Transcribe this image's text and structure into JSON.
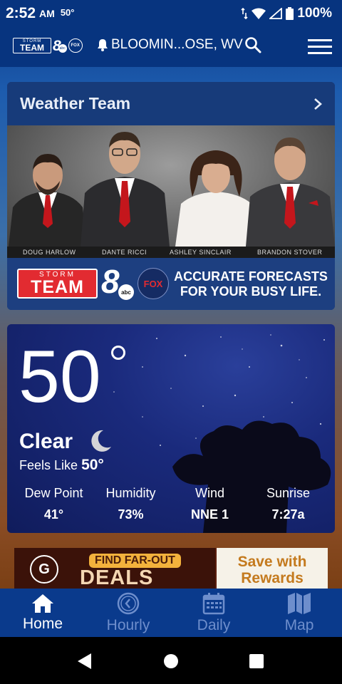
{
  "status_bar": {
    "time": "2:52",
    "ampm": "AM",
    "temperature": "50°",
    "battery": "100%"
  },
  "app_bar": {
    "logo_text_top": "STORM",
    "logo_text_bottom": "TEAM",
    "logo_channel": "8",
    "logo_abc": "abc",
    "logo_fox": "FOX",
    "location": "BLOOMIN...OSE, WV"
  },
  "weather_team": {
    "title": "Weather Team",
    "members": [
      "DOUG HARLOW",
      "DANTE RICCI",
      "ASHLEY SINCLAIR",
      "BRANDON STOVER"
    ],
    "promo": {
      "logo_top": "STORM",
      "logo_bottom": "TEAM",
      "channel": "8",
      "abc": "abc",
      "fox": "FOX",
      "tagline_1": "ACCURATE FORECASTS",
      "tagline_2": "FOR YOUR BUSY LIFE."
    }
  },
  "current": {
    "temperature": "50",
    "condition": "Clear",
    "feels_like_label": "Feels Like",
    "feels_like_value": "50°",
    "stats": [
      {
        "label": "Dew Point",
        "value": "41°"
      },
      {
        "label": "Humidity",
        "value": "73%"
      },
      {
        "label": "Wind",
        "value": "NNE 1"
      },
      {
        "label": "Sunrise",
        "value": "7:27a"
      }
    ]
  },
  "ad": {
    "logo": "G",
    "find_text": "FIND FAR-OUT",
    "deals_text": "DEALS",
    "right_text_1": "Save with",
    "right_text_2": "Rewards"
  },
  "bottom_nav": [
    {
      "label": "Home",
      "icon": "home-icon",
      "active": true
    },
    {
      "label": "Hourly",
      "icon": "clock-icon",
      "active": false
    },
    {
      "label": "Daily",
      "icon": "calendar-icon",
      "active": false
    },
    {
      "label": "Map",
      "icon": "map-icon",
      "active": false
    }
  ],
  "colors": {
    "app_bar": "#07347f",
    "bottom_nav": "#0a3a8c",
    "active": "#ffffff",
    "inactive": "#6e8ecc",
    "accent_red": "#e22b31"
  }
}
